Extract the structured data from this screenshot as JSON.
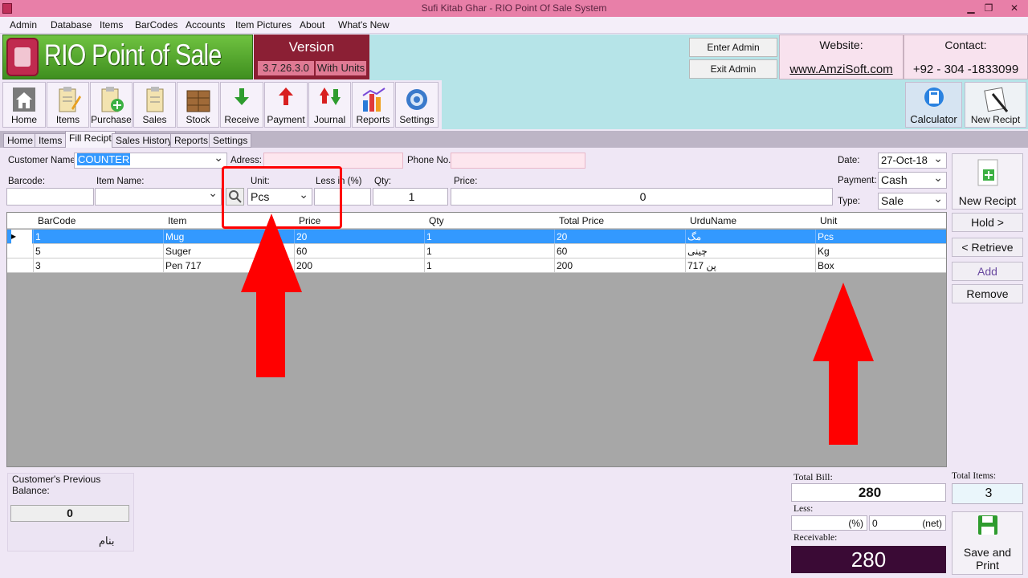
{
  "window": {
    "title": "Sufi Kitab Ghar - RIO Point Of Sale System",
    "minimize": "▁",
    "maximize": "❐",
    "close": "✕"
  },
  "menu": [
    "Admin",
    "Database",
    "Items",
    "BarCodes",
    "Accounts",
    "Item Pictures",
    "About",
    "What's New"
  ],
  "brand": {
    "name": "RIO Point of Sale",
    "version_label": "Version",
    "version_number": "3.7.26.3.0",
    "edition": "With Units"
  },
  "admin": {
    "enter": "Enter Admin",
    "exit": "Exit Admin"
  },
  "website": {
    "label": "Website:",
    "value": "www.AmziSoft.com"
  },
  "contact": {
    "label": "Contact:",
    "value": "+92 - 304 -1833099"
  },
  "toolbar": [
    "Home",
    "Items",
    "Purchase",
    "Sales",
    "Stock",
    "Receive",
    "Payment",
    "Journal",
    "Reports",
    "Settings"
  ],
  "toolbar_right": {
    "calculator": "Calculator",
    "new_recipt": "New Recipt"
  },
  "tabs": [
    "Home",
    "Items",
    "Fill Recipt",
    "Sales History",
    "Reports",
    "Settings"
  ],
  "active_tab": "Fill Recipt",
  "form": {
    "customer_label": "Customer Name:",
    "customer_value": "COUNTER",
    "address_label": "Adress:",
    "address_value": "",
    "phone_label": "Phone No.",
    "phone_value": "",
    "date_label": "Date:",
    "date_value": "27-Oct-18",
    "payment_label": "Payment:",
    "payment_value": "Cash",
    "type_label": "Type:",
    "type_value": "Sale",
    "barcode_label": "Barcode:",
    "barcode_value": "",
    "itemname_label": "Item Name:",
    "itemname_value": "",
    "unit_label": "Unit:",
    "unit_value": "Pcs",
    "less_label": "Less in (%)",
    "less_value": "",
    "qty_label": "Qty:",
    "qty_value": "1",
    "price_label": "Price:",
    "price_value": "0"
  },
  "grid": {
    "columns": [
      "BarCode",
      "Item",
      "Price",
      "Qty",
      "Total Price",
      "UrduName",
      "Unit"
    ],
    "rows": [
      {
        "barcode": "1",
        "item": "Mug",
        "price": "20",
        "qty": "1",
        "total": "20",
        "urdu": "مگ",
        "unit": "Pcs"
      },
      {
        "barcode": "5",
        "item": "Suger",
        "price": "60",
        "qty": "1",
        "total": "60",
        "urdu": "چینی",
        "unit": "Kg"
      },
      {
        "barcode": "3",
        "item": "Pen 717",
        "price": "200",
        "qty": "1",
        "total": "200",
        "urdu": "717 پن",
        "unit": "Box"
      }
    ]
  },
  "side_buttons": {
    "new_recipt": "New Recipt",
    "hold": "Hold >",
    "retrieve": "< Retrieve",
    "add": "Add",
    "remove": "Remove"
  },
  "bottom": {
    "prev_balance_label": "Customer's Previous Balance:",
    "prev_balance_value": "0",
    "urdu_note": "بنام",
    "total_bill_label": "Total Bill:",
    "total_bill_value": "280",
    "less_label": "Less:",
    "less_pct_unit": "(%)",
    "less_net_value": "0",
    "less_net_unit": "(net)",
    "receivable_label": "Receivable:",
    "receivable_value": "280",
    "total_items_label": "Total Items:",
    "total_items_value": "3",
    "save_print": "Save and Print"
  },
  "colors": {
    "highlight": "#3399ff",
    "annotation": "#ff0000",
    "receivable_bg": "#3a0a35"
  }
}
